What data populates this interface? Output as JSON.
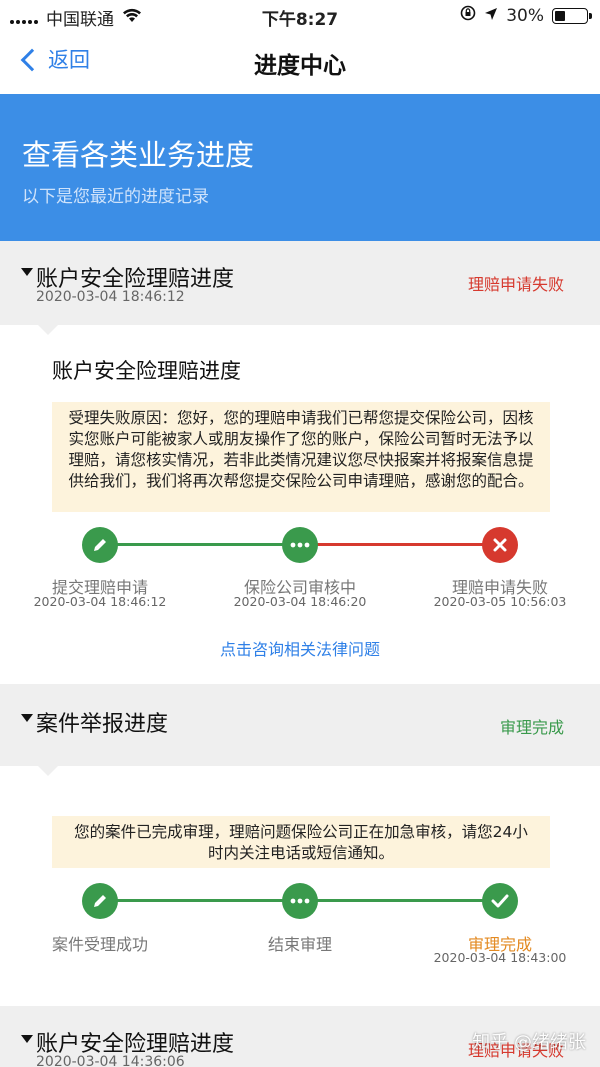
{
  "status_bar": {
    "carrier": "中国联通",
    "time": "下午8:27",
    "battery": "30%",
    "battery_level": 0.3
  },
  "nav": {
    "back_label": "返回",
    "title": "进度中心"
  },
  "banner": {
    "title": "查看各类业务进度",
    "subtitle": "以下是您最近的进度记录"
  },
  "sections": [
    {
      "title": "账户安全险理赔进度",
      "date": "2020-03-04 18:46:12",
      "status": "理赔申请失败",
      "card_title": "账户安全险理赔进度",
      "notice": "受理失败原因：您好，您的理赔申请我们已帮您提交保险公司，因核实您账户可能被家人或朋友操作了您的账户，保险公司暂时无法予以理赔，请您核实情况，若非此类情况建议您尽快报案并将报案信息提供给我们，我们将再次帮您提交保险公司申请理赔，感谢您的配合。",
      "steps": [
        {
          "label": "提交理赔申请",
          "time": "2020-03-04 18:46:12",
          "icon": "pencil-icon"
        },
        {
          "label": "保险公司审核中",
          "time": "2020-03-04 18:46:20",
          "icon": "more-icon"
        },
        {
          "label": "理赔申请失败",
          "time": "2020-03-05 10:56:03",
          "icon": "close-icon"
        }
      ],
      "link": "点击咨询相关法律问题"
    },
    {
      "title": "案件举报进度",
      "status": "审理完成",
      "notice": "您的案件已完成审理，理赔问题保险公司正在加急审核，请您24小时内关注电话或短信通知。",
      "steps": [
        {
          "label": "案件受理成功",
          "icon": "pencil-icon"
        },
        {
          "label": "结束审理",
          "icon": "more-icon"
        },
        {
          "label": "审理完成",
          "time": "2020-03-04 18:43:00",
          "icon": "check-icon"
        }
      ]
    },
    {
      "title": "账户安全险理赔进度",
      "date": "2020-03-04 14:36:06",
      "status": "理赔申请失败"
    }
  ],
  "watermark": "知乎 @绪绪张",
  "colors": {
    "accent_blue": "#3c8ee6",
    "link_blue": "#2f80e7",
    "success_green": "#3a9a4c",
    "fail_red": "#d6392e",
    "notice_bg": "#fdf3dc"
  }
}
